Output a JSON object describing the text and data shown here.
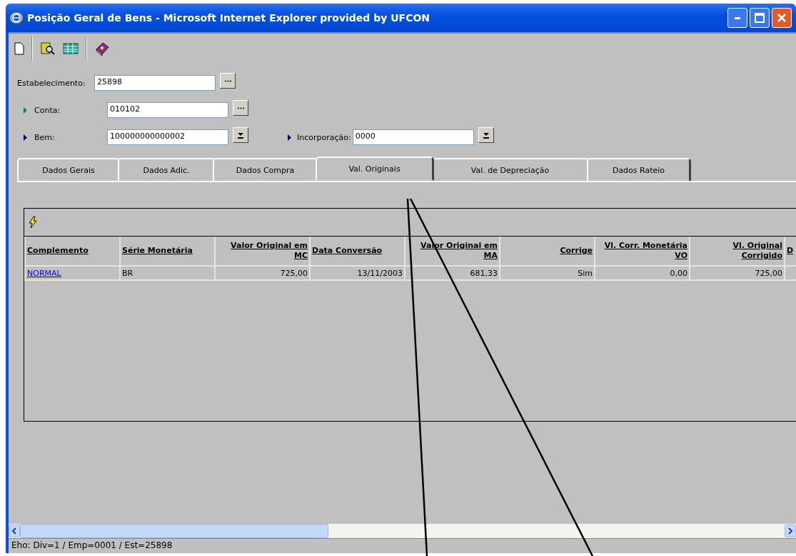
{
  "window": {
    "title": "Posição Geral de Bens - Microsoft Internet Explorer provided by UFCON"
  },
  "fields": [
    {
      "label": "Estabelecimento:",
      "value": "25898",
      "kind": "lookup"
    },
    {
      "label": "Conta:",
      "value": "010102",
      "kind": "lookup",
      "color": "#008080"
    },
    {
      "label": "Bem:",
      "value": "100000000000002",
      "kind": "dropdown",
      "color": "#000080"
    }
  ],
  "side_field": {
    "label": "Incorporação:",
    "value": "0000",
    "kind": "dropdown",
    "color": "#000080"
  },
  "tabs": [
    {
      "label": "Dados Gerais",
      "selected": false
    },
    {
      "label": "Dados Adic.",
      "selected": false
    },
    {
      "label": "Dados Compra",
      "selected": false
    },
    {
      "label": "Val. Originais",
      "selected": true
    },
    {
      "label": "Val. de Depreciação",
      "selected": false
    },
    {
      "label": "Dados Rateio",
      "selected": false
    }
  ],
  "table": {
    "columns": [
      "Complemento",
      "Série Monetária",
      "Valor Original em MC",
      "Data Conversão",
      "Valor Original em MA",
      "Corrige",
      "Vl. Corr. Monetária VO",
      "Vl. Original Corrigido",
      "D"
    ],
    "rows": [
      [
        {
          "text": "NORMAL",
          "kind": "link"
        },
        {
          "text": "BR"
        },
        {
          "text": "725,00"
        },
        {
          "text": "13/11/2003"
        },
        {
          "text": "681,33"
        },
        {
          "text": "Sim"
        },
        {
          "text": "0,00"
        },
        {
          "text": "725,00"
        }
      ]
    ]
  },
  "status_bar": "Eho: Div=1 / Emp=0001 / Est=25898"
}
